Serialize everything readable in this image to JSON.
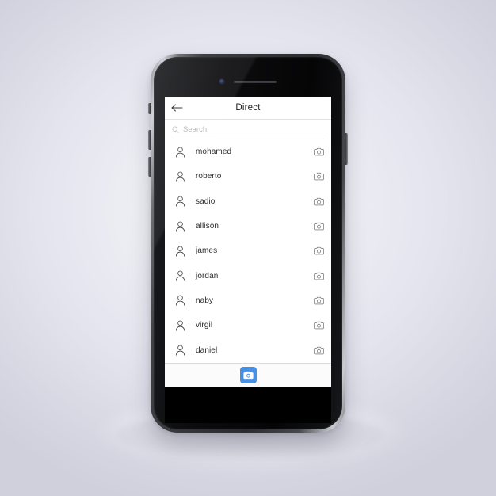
{
  "scene": {
    "background_center_color": "#f4f4f8",
    "background_edge_color": "#d0d0dd",
    "device_name": "smartphone-mockup"
  },
  "device": {
    "frame_color": "#2a2c30",
    "bezel_color": "#050506",
    "sensors": {
      "front_camera": "front-camera-dot",
      "earpiece": "earpiece-speaker"
    },
    "buttons": {
      "silent_switch": "silent-switch",
      "volume_up": "volume-up-button",
      "volume_down": "volume-down-button",
      "power": "power-button"
    }
  },
  "app": {
    "navbar": {
      "back_icon": "arrow-left-icon",
      "title": "Direct"
    },
    "search": {
      "icon": "search-icon",
      "placeholder": "Search",
      "value": ""
    },
    "contacts": [
      {
        "name": "mohamed",
        "avatar_icon": "person-icon",
        "action_icon": "camera-icon"
      },
      {
        "name": "roberto",
        "avatar_icon": "person-icon",
        "action_icon": "camera-icon"
      },
      {
        "name": "sadio",
        "avatar_icon": "person-icon",
        "action_icon": "camera-icon"
      },
      {
        "name": "allison",
        "avatar_icon": "person-icon",
        "action_icon": "camera-icon"
      },
      {
        "name": "james",
        "avatar_icon": "person-icon",
        "action_icon": "camera-icon"
      },
      {
        "name": "jordan",
        "avatar_icon": "person-icon",
        "action_icon": "camera-icon"
      },
      {
        "name": "naby",
        "avatar_icon": "person-icon",
        "action_icon": "camera-icon"
      },
      {
        "name": "virgil",
        "avatar_icon": "person-icon",
        "action_icon": "camera-icon"
      },
      {
        "name": "daniel",
        "avatar_icon": "person-icon",
        "action_icon": "camera-icon"
      }
    ],
    "tabbar": {
      "camera_button_icon": "camera-icon",
      "camera_button_color": "#4a90e2"
    }
  }
}
